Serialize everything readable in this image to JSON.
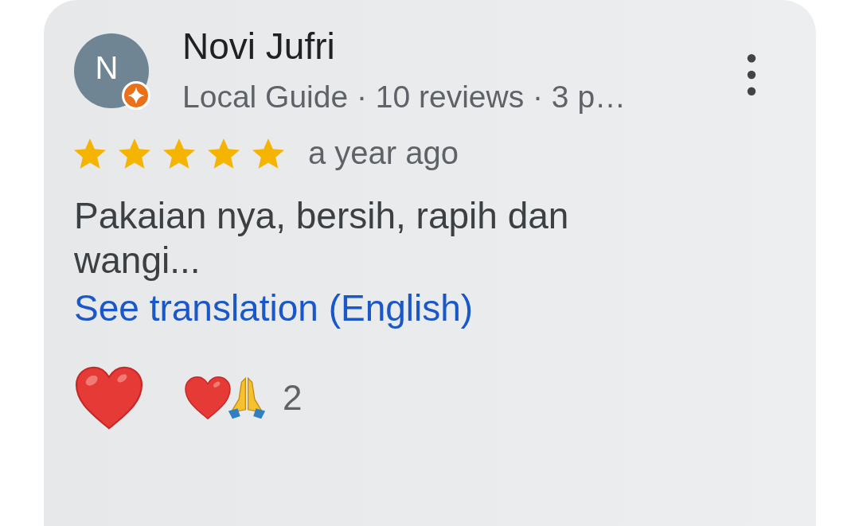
{
  "review": {
    "avatar_letter": "N",
    "local_guide": true,
    "author": "Novi Jufri",
    "meta": "Local Guide · 10 reviews · 3 p…",
    "stars": 5,
    "time": "a year ago",
    "text": "Pakaian nya, bersih, rapih dan wangi...",
    "translate_link": "See translation (English)",
    "reaction_count": "2"
  }
}
